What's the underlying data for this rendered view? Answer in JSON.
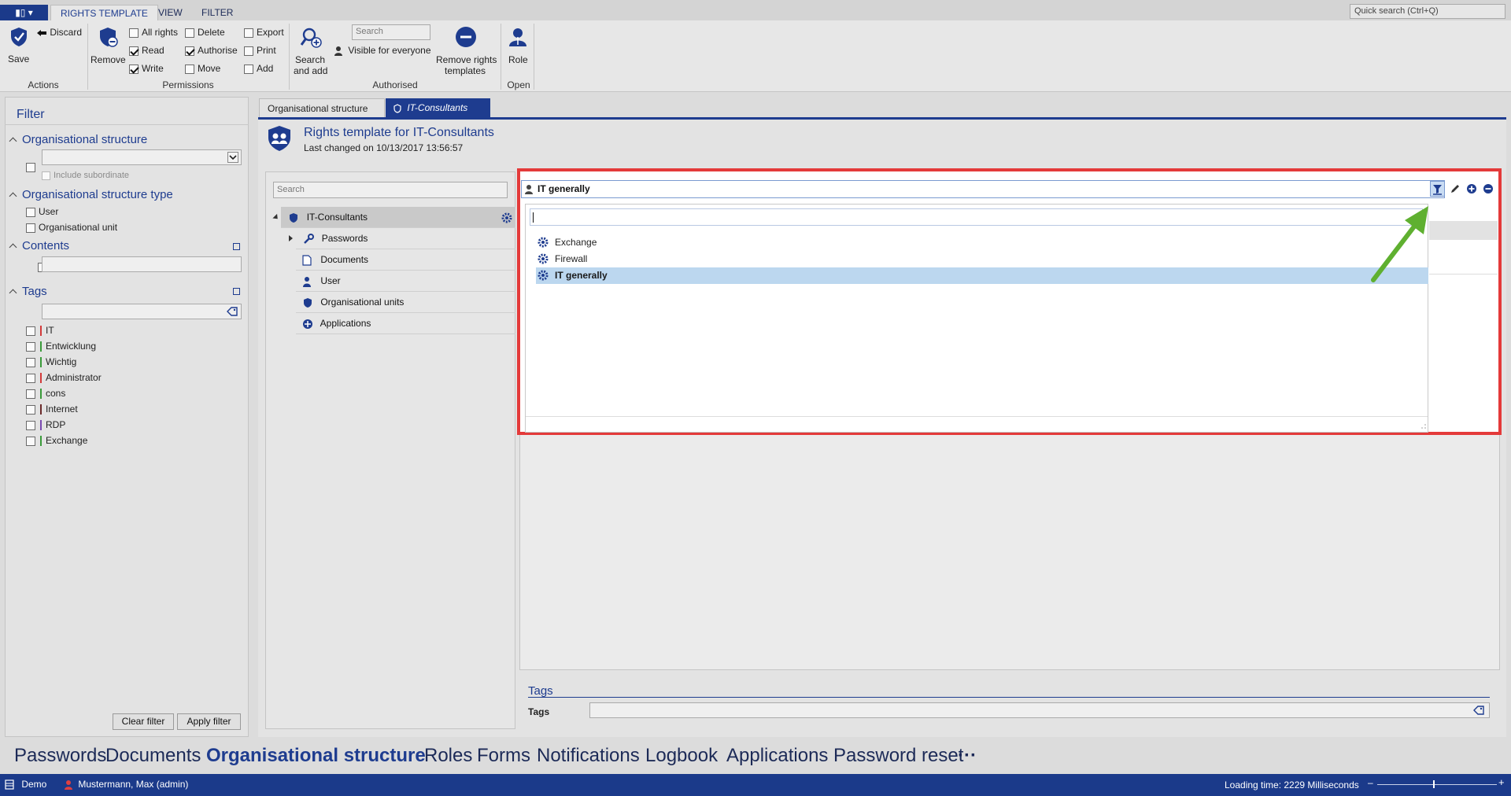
{
  "app_menu": {
    "label": "▮▯ ▾"
  },
  "ribbon_tabs": [
    "RIGHTS TEMPLATE",
    "VIEW",
    "FILTER"
  ],
  "quick_search": {
    "placeholder": "Quick search (Ctrl+Q)"
  },
  "ribbon": {
    "save": "Save",
    "discard": "Discard",
    "remove": "Remove",
    "permissions": [
      {
        "label": "All rights",
        "checked": false
      },
      {
        "label": "Read",
        "checked": true
      },
      {
        "label": "Write",
        "checked": true
      },
      {
        "label": "Delete",
        "checked": false
      },
      {
        "label": "Authorise",
        "checked": true
      },
      {
        "label": "Move",
        "checked": false
      },
      {
        "label": "Export",
        "checked": false
      },
      {
        "label": "Print",
        "checked": false
      },
      {
        "label": "Add",
        "checked": false
      }
    ],
    "search_placeholder": "Search",
    "search_and_add_1": "Search",
    "search_and_add_2": "and add",
    "visible_for_everyone": "Visible for everyone",
    "remove_rights_1": "Remove rights",
    "remove_rights_2": "templates",
    "role": "Role",
    "groups": {
      "actions": "Actions",
      "permissions": "Permissions",
      "authorised": "Authorised",
      "open": "Open"
    }
  },
  "filter": {
    "title": "Filter",
    "org_structure": "Organisational structure",
    "include_subordinate": "Include subordinate",
    "org_structure_type": "Organisational structure type",
    "type_user": "User",
    "type_org_unit": "Organisational unit",
    "contents": "Contents",
    "tags_title": "Tags",
    "tags": [
      {
        "name": "IT",
        "color": "#d23a3a"
      },
      {
        "name": "Entwicklung",
        "color": "#3a9a3a"
      },
      {
        "name": "Wichtig",
        "color": "#3a9a3a"
      },
      {
        "name": "Administrator",
        "color": "#d23a3a"
      },
      {
        "name": "cons",
        "color": "#3a9a3a"
      },
      {
        "name": "Internet",
        "color": "#6b2a2a"
      },
      {
        "name": "RDP",
        "color": "#7a4ab0"
      },
      {
        "name": "Exchange",
        "color": "#3a9a3a"
      }
    ],
    "clear_filter": "Clear filter",
    "apply_filter": "Apply filter"
  },
  "doc_tabs": {
    "org": "Organisational structure",
    "it": "IT-Consultants"
  },
  "rights_template": {
    "title": "Rights template for IT-Consultants",
    "last_changed": "Last changed on 10/13/2017 13:56:57"
  },
  "tree": {
    "search_placeholder": "Search",
    "root": "IT-Consultants",
    "children": [
      "Passwords",
      "Documents",
      "User",
      "Organisational units",
      "Applications"
    ]
  },
  "dropdown": {
    "selected": "IT generally",
    "items": [
      "Exchange",
      "Firewall",
      "IT generally"
    ]
  },
  "tags_section": {
    "title": "Tags",
    "field_label": "Tags"
  },
  "modules": [
    "Passwords",
    "Documents",
    "Organisational structure",
    "Roles",
    "Forms",
    "Notifications",
    "Logbook",
    "Applications",
    "Password reset",
    "···"
  ],
  "status": {
    "database": "Demo",
    "user": "Mustermann, Max (admin)",
    "loading": "Loading time: 2229 Milliseconds"
  },
  "colors": {
    "accent": "#1e3c8f",
    "highlight_frame": "#e43a3a",
    "arrow": "#5fb030",
    "status_bar": "#1b3a8a"
  }
}
